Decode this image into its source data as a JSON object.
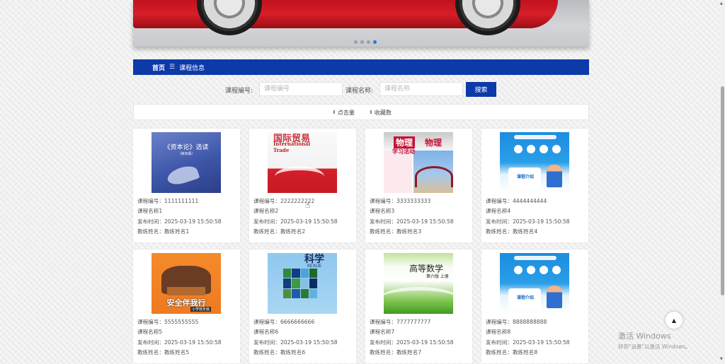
{
  "banner": {
    "slide_count": 4,
    "active_slide": 4
  },
  "breadcrumb": {
    "home": "首页",
    "separator": "☰",
    "current": "课程信息"
  },
  "search": {
    "code_label": "课程编号:",
    "code_placeholder": "课程编号",
    "name_label": "课程名称:",
    "name_placeholder": "课程名称",
    "button": "搜索"
  },
  "sort": {
    "clicks": "点击量",
    "favorites": "收藏数"
  },
  "courses": [
    {
      "code": "1111111111",
      "name": "课程名称1",
      "date": "2025-03-19 15:50:58",
      "coach": "教练姓名1",
      "cover": {
        "title": "《资本论》选读",
        "subtitle": "（第四版）"
      }
    },
    {
      "code": "2222222222",
      "name": "课程名称2",
      "date": "2025-03-19 15:50:58",
      "coach": "教练姓名2",
      "cover": {
        "title": "国际贸易",
        "line1": "International",
        "line2": "Trade"
      }
    },
    {
      "code": "3333333333",
      "name": "课程名称3",
      "date": "2025-03-19 15:50:58",
      "coach": "教练姓名3",
      "cover": {
        "title": "物理",
        "title2": "物理",
        "line1": "学习活动"
      }
    },
    {
      "code": "4444444444",
      "name": "课程名称4",
      "date": "2025-03-19 15:50:58",
      "coach": "教练姓名4",
      "cover": {
        "title": "课程介绍"
      }
    },
    {
      "code": "5555555555",
      "name": "课程名称5",
      "date": "2025-03-19 15:50:58",
      "coach": "教练姓名5",
      "cover": {
        "title": "安全伴我行",
        "tag": "小学低年级"
      }
    },
    {
      "code": "6666666666",
      "name": "课程名称6",
      "date": "2025-03-19 15:50:58",
      "coach": "教练姓名6",
      "cover": {
        "title": "科学",
        "line1": "KEXUE"
      }
    },
    {
      "code": "7777777777",
      "name": "课程名称7",
      "date": "2025-03-19 15:50:58",
      "coach": "教练姓名7",
      "cover": {
        "title": "高等数学",
        "line1": "第六版 上册"
      }
    },
    {
      "code": "8888888888",
      "name": "课程名称8",
      "date": "2025-03-19 15:50:58",
      "coach": "教练姓名8",
      "cover": {
        "title": "课程介绍"
      }
    }
  ],
  "field_labels": {
    "code": "课程编号：",
    "name_prefix": "",
    "date": "发布时间：",
    "coach": "教练姓名："
  },
  "scroll_top": "▲",
  "watermark": {
    "line1": "激活 Windows",
    "line2": "转到\"设置\"以激活 Windows。"
  },
  "colors": {
    "primary": "#0c3aa8",
    "dot_active": "#1e7be0"
  }
}
